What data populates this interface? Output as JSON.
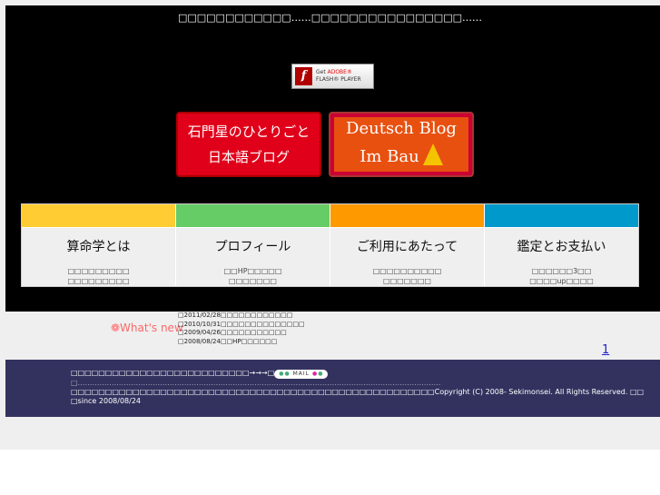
{
  "header": {
    "tagline": "□□□□□□□□□□□□……□□□□□□□□□□□□□□□□……",
    "flash": {
      "line1a": "Get ",
      "line1b": "ADOBE®",
      "line2": "FLASH® PLAYER"
    }
  },
  "banners": {
    "japanese": {
      "line1": "石門星のひとりごと",
      "line2": "日本語ブログ"
    },
    "german": {
      "line1": "Deutsch Blog",
      "line2": "Im Bau"
    }
  },
  "nav": [
    {
      "title": "算命学とは",
      "desc1": "□□□□□□□□□",
      "desc2": "□□□□□□□□□",
      "color": "#ffcc33"
    },
    {
      "title": "プロフィール",
      "desc1": "□□HP□□□□□",
      "desc2": "□□□□□□□",
      "color": "#66cc66"
    },
    {
      "title": "ご利用にあたって",
      "desc1": "□□□□□□□□□□",
      "desc2": "□□□□□□□",
      "color": "#ff9900"
    },
    {
      "title": "鑑定とお支払い",
      "desc1": "□□□□□□3□□",
      "desc2": "□□□□up□□□□",
      "color": "#0099cc"
    }
  ],
  "whats_new": {
    "label": "❁What's new",
    "items": [
      "□2011/02/28□□□□□□□□□□□□",
      "□2010/10/31□□□□□□□□□□□□□□",
      "□2009/04/26□□□□□□□□□□□",
      "□2008/08/24□□HP□□□□□□"
    ]
  },
  "pagination": {
    "page": "1"
  },
  "footer": {
    "line1": "□□□□□□□□□□□□□□□□□□□□□□□□□□→→→□",
    "mail": "MAIL",
    "line2": "□……………………………………………………………………………………………………………………………………",
    "line3": "□□□□□□□□□□□□□□□□□□□□□□□□□□□□□□□□□□□□□□□□□□□□□□□□□□□□□Copyright (C) 2008- Sekimonsei. All Rights Reserved. □□",
    "line4": "□since 2008/08/24"
  }
}
